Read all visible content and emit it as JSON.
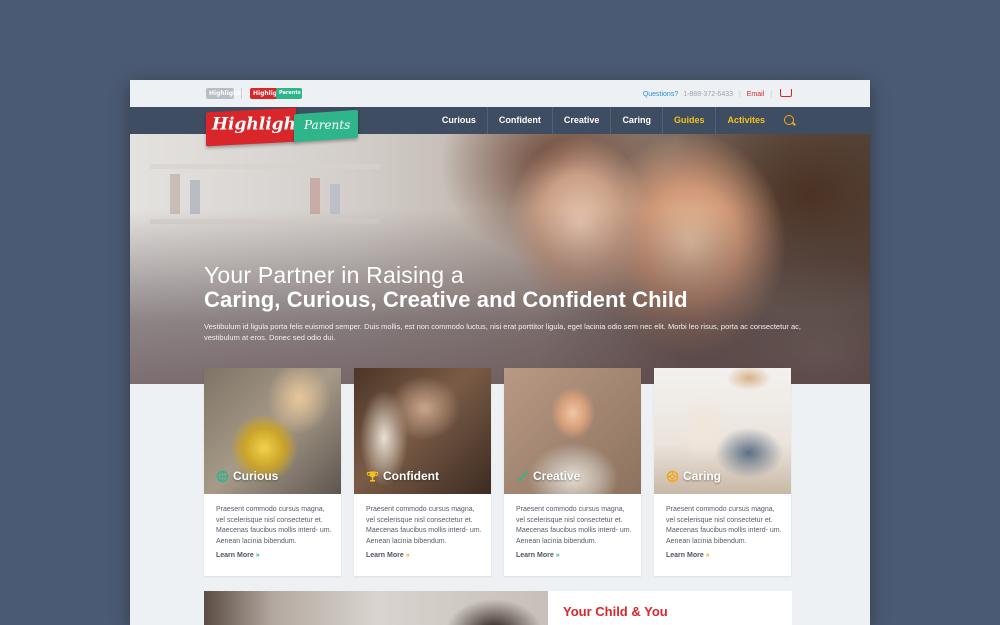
{
  "util": {
    "mini_logo_1": "Highlights",
    "mini_logo_2": "Highlights",
    "mini_logo_3": "Parents",
    "questions": "Questions?",
    "phone": "1-888-372-6433",
    "email": "Email"
  },
  "logo": {
    "brand": "Highlights",
    "sub": "Parents"
  },
  "nav": {
    "items": [
      "Curious",
      "Confident",
      "Creative",
      "Caring",
      "Guides",
      "Activites"
    ]
  },
  "hero": {
    "title_line1": "Your Partner in Raising a",
    "title_line2": "Caring, Curious, Creative and Confident Child",
    "body": "Vestibulum id ligula porta felis euismod semper. Duis mollis, est non commodo luctus, nisi erat porttitor ligula, eget lacinia odio sem nec elit. Morbi leo risus, porta ac consectetur ac, vestibulum at eros. Donec sed odio dui."
  },
  "cards": [
    {
      "label": "Curious",
      "icon": "globe-icon",
      "text": "Praesent commodo cursus magna, vel scelerisque nisl consectetur et. Maecenas faucibus mollis interd- um. Aenean lacinia bibendum.",
      "link": "Learn More",
      "arrow": "»"
    },
    {
      "label": "Confident",
      "icon": "trophy-icon",
      "text": "Praesent commodo cursus magna, vel scelerisque nisl consectetur et. Maecenas faucibus mollis interd- um. Aenean lacinia bibendum.",
      "link": "Learn More",
      "arrow": "»"
    },
    {
      "label": "Creative",
      "icon": "paintbrush-icon",
      "text": "Praesent commodo cursus magna, vel scelerisque nisl consectetur et. Maecenas faucibus mollis interd- um. Aenean lacinia bibendum.",
      "link": "Learn More",
      "arrow": "»"
    },
    {
      "label": "Caring",
      "icon": "lifebuoy-icon",
      "text": "Praesent commodo cursus magna, vel scelerisque nisl consectetur et. Maecenas faucibus mollis interd- um. Aenean lacinia bibendum.",
      "link": "Learn More",
      "arrow": "»"
    }
  ],
  "section": {
    "title": "Your Child & You"
  },
  "colors": {
    "brand_red": "#d9262b",
    "brand_green": "#2fb58a",
    "nav_bg": "#3f4d62",
    "gold": "#f2c21b",
    "page_bg": "#4b5a74"
  }
}
